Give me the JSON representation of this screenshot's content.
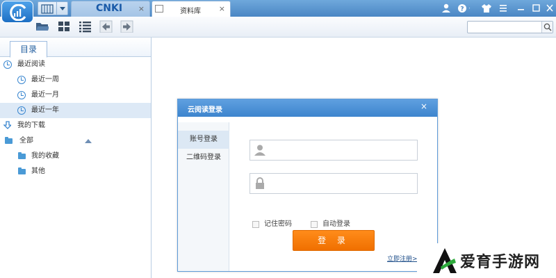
{
  "titlebar": {
    "tabs": [
      {
        "name": "cnki",
        "label": "CNKI",
        "close": "×"
      },
      {
        "name": "library",
        "label": "资料库",
        "close": "×"
      }
    ],
    "window_controls": [
      "user-icon",
      "help-icon",
      "skin-icon",
      "menu-icon",
      "minimize-icon",
      "maximize-icon",
      "close-icon"
    ]
  },
  "toolbar": {
    "buttons": [
      "open-folder-icon",
      "grid-view-icon",
      "list-view-icon",
      "back-icon",
      "forward-icon"
    ],
    "search": {
      "placeholder": "",
      "value": ""
    }
  },
  "sidebar": {
    "tab_label": "目录",
    "items": [
      {
        "label": "最近阅读",
        "icon": "clock-icon",
        "level": 0
      },
      {
        "label": "最近一周",
        "icon": "clock-icon",
        "level": 1
      },
      {
        "label": "最近一月",
        "icon": "clock-icon",
        "level": 1
      },
      {
        "label": "最近一年",
        "icon": "clock-icon",
        "level": 1,
        "selected": true
      },
      {
        "label": "我的下载",
        "icon": "download-icon",
        "level": 0
      },
      {
        "label": "全部",
        "icon": "folder-icon",
        "level": 0
      },
      {
        "label": "我的收藏",
        "icon": "folder-icon",
        "level": 1
      },
      {
        "label": "其他",
        "icon": "folder-icon",
        "level": 1
      }
    ]
  },
  "dialog": {
    "title": "云阅读登录",
    "close": "×",
    "tabs": [
      {
        "label": "账号登录",
        "active": true
      },
      {
        "label": "二维码登录",
        "active": false
      }
    ],
    "username": {
      "value": "",
      "placeholder": ""
    },
    "password": {
      "value": "",
      "placeholder": ""
    },
    "remember_password": "记住密码",
    "auto_login": "自动登录",
    "login_button": "登 录",
    "register_link": "立即注册>"
  },
  "watermark": {
    "text": "爱育手游网"
  },
  "colors": {
    "accent": "#3d84cd",
    "login_button": "#f07000",
    "selected_row": "#dde9f6"
  }
}
